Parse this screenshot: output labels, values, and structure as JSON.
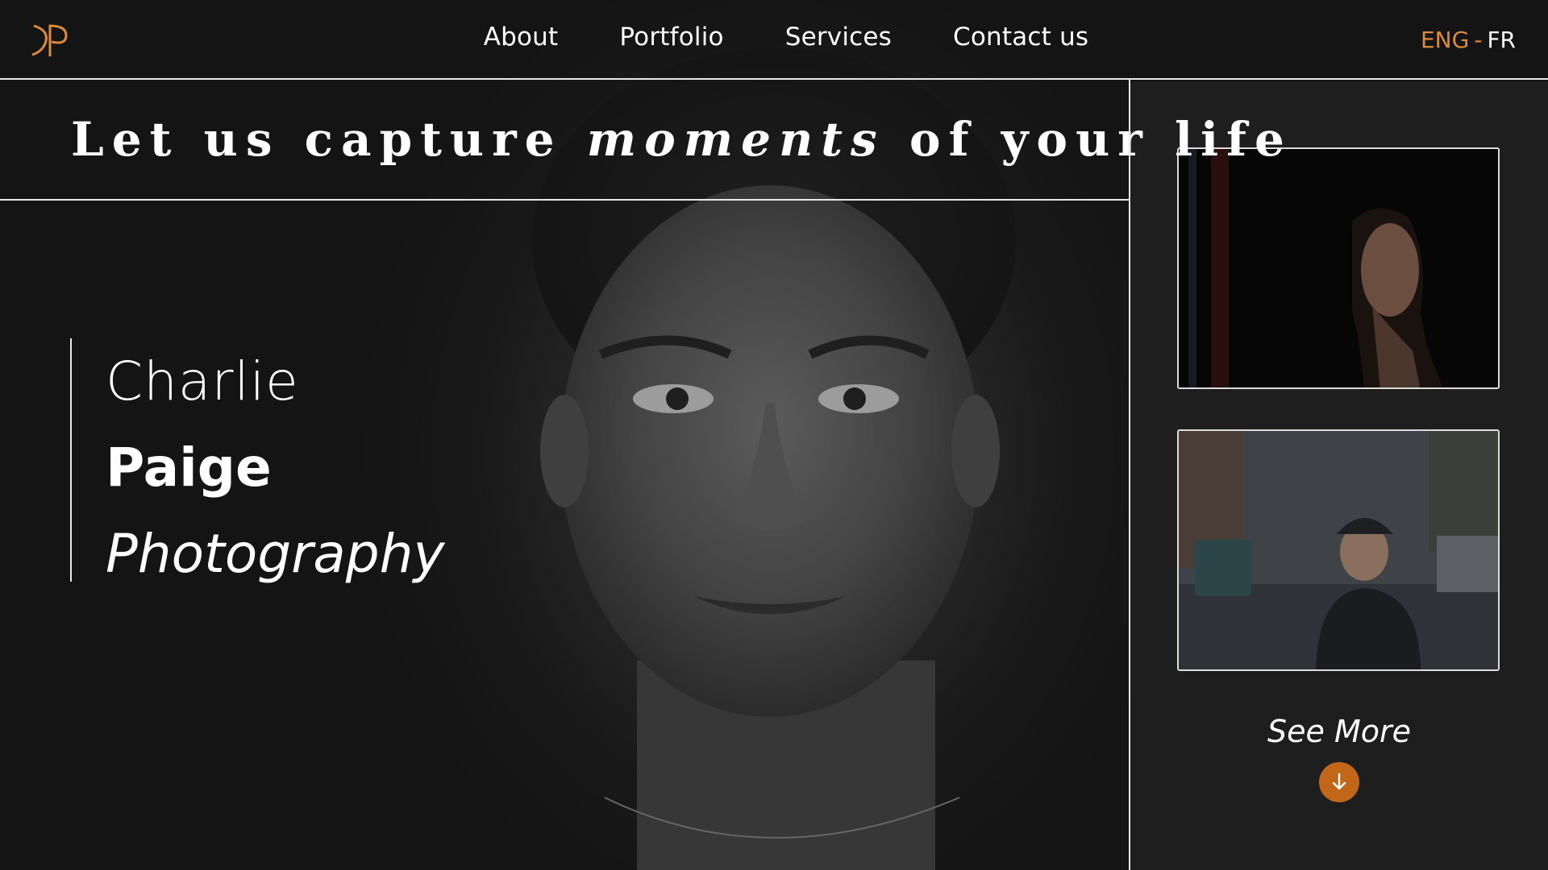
{
  "nav": {
    "items": [
      {
        "label": "About"
      },
      {
        "label": "Portfolio"
      },
      {
        "label": "Services"
      },
      {
        "label": "Contact us"
      }
    ],
    "lang": {
      "eng": "ENG",
      "separator": "-",
      "fr": "FR"
    }
  },
  "headline": {
    "before": "Let us capture ",
    "emphasis": "moments",
    "after": " of your life"
  },
  "name": {
    "first": "Charlie",
    "last": "Paige",
    "tagline": "Photography"
  },
  "gallery": {
    "see_more": "See More",
    "scroll_icon": "arrow-down-icon"
  },
  "colors": {
    "accent": "#d98c3c",
    "button": "#c2661a",
    "background": "#1a1a1a",
    "line": "#e8e8e8"
  }
}
